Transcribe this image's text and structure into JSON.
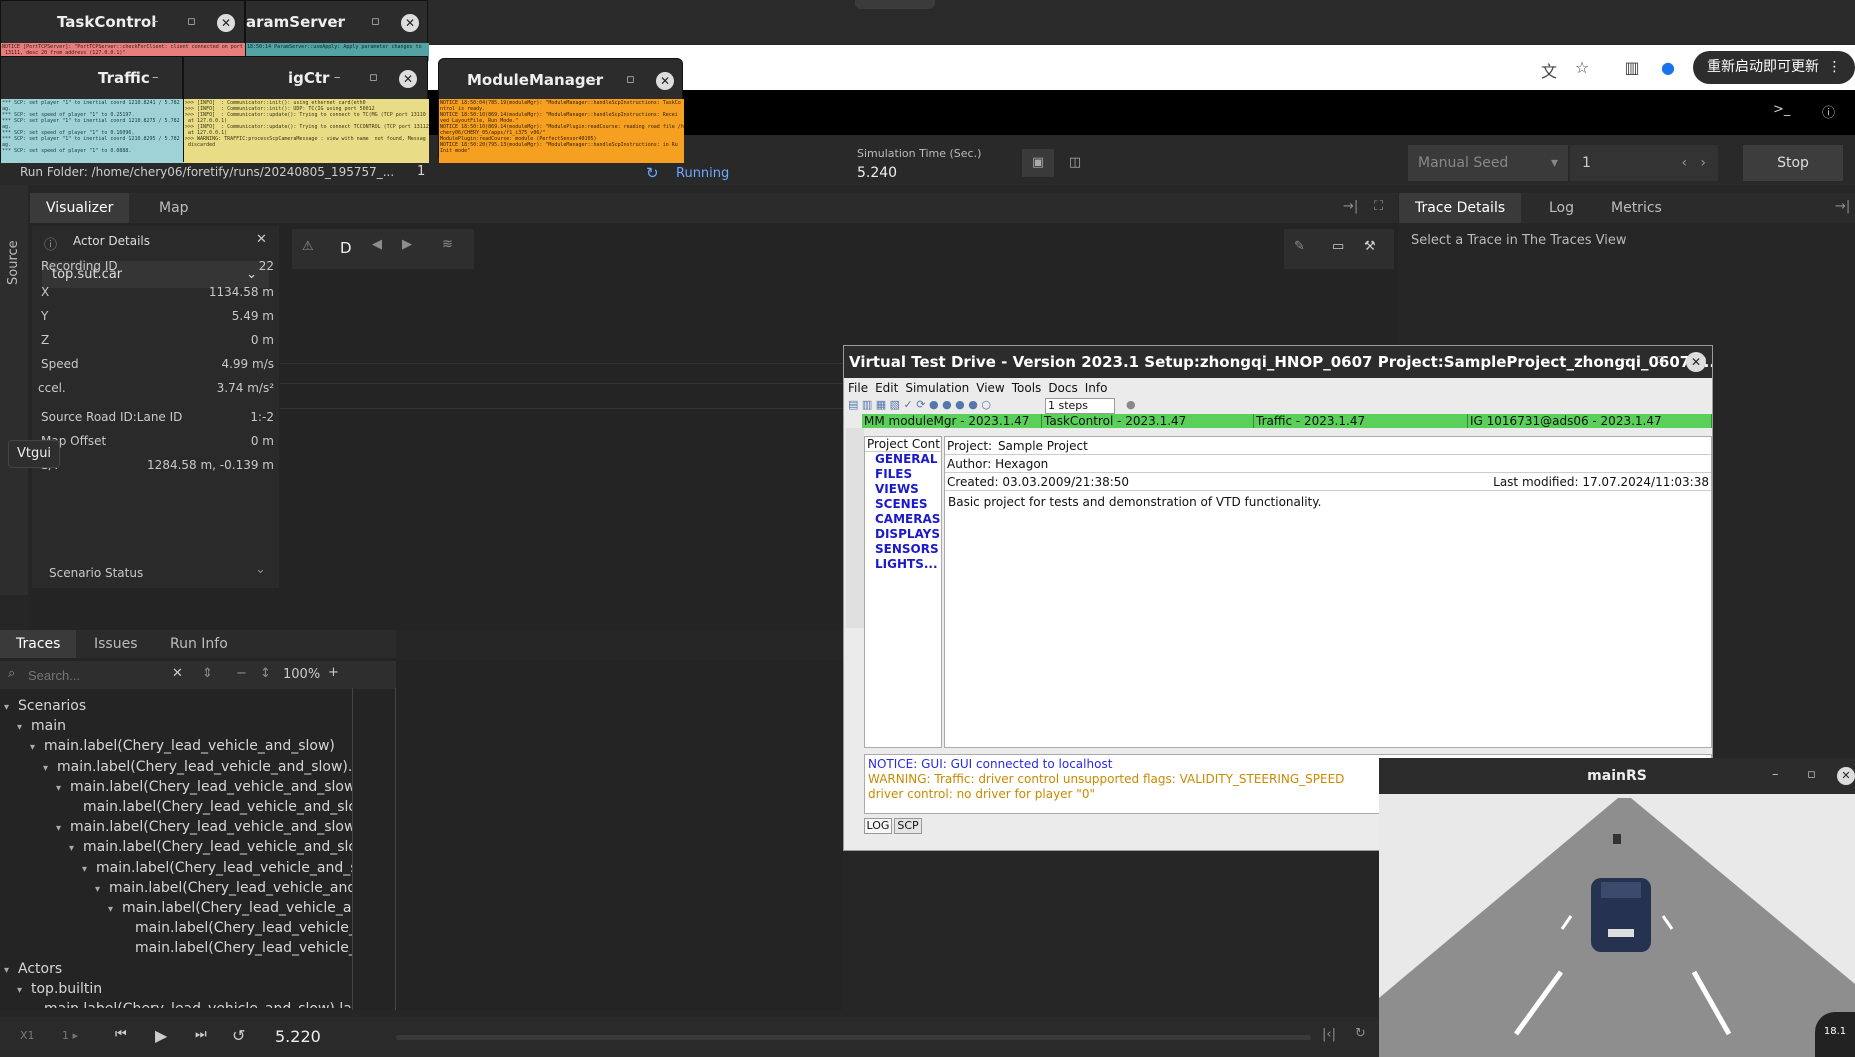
{
  "windows": {
    "task_control": {
      "title": "TaskControl",
      "log": "NOTICE [PortTCPServer]: \"PortTCPServer::checkForClient: client connected on port\n 13111, desc 20 from address (127.0.0.1)\""
    },
    "param_server": {
      "title": "aramServer",
      "log": "18:50:14 ParamServer::useApply: Apply parameter changes to"
    },
    "traffic": {
      "title": "Traffic",
      "log": "*** SCP: set player \"1\" to inertial coord 1210.8241 / 5.782\nag.\n*** SCP: set speed of player \"1\" to 0.25197.\n*** SCP: set player \"1\" to inertial coord 1210.8275 / 5.782\nag.\n*** SCP: set speed of player \"1\" to 0.16096.\n*** SCP: set player \"1\" to inertial coord 1210.8295 / 5.782\nag.\n*** SCP: set speed of player \"1\" to 0.0888."
    },
    "igctr": {
      "title": "igCtr",
      "log": ">>> [INFO]  : Communicator::init(): using ethernet card(eth0\n>>> [INFO]  : Communicator::init(): UDP: TC(IG using port 50012\n>>> [INFO]  : Communicator::update(): Trying to connect to TC(MG (TCP port 13110\n at 127.0.0.1)\n>>> [INFO]  : Communicator::update(): Trying to connect TCCONTROL (TCP port 13112\n at 127.0.0.1)\n>>> WARNING: TRAFFIC:processScpCameraMessage : view with name  not found, Messag\n discarded"
    },
    "module_manager": {
      "title": "ModuleManager",
      "log": "NOTICE 18:50:04(785.19(moduleMgr): \"ModuleManager::handleScpInstructions: TaskCo\nntrol is ready.\nNOTICE 18:50:10(869.14(moduleMgr): \"ModuleManager::handleScpInstructions: Recei\nved LayoutFile, Run Mode.\"\nNOTICE 18:50:10(869.14(moduleMgr): \"ModulePlugin:readCourse: reading road file /home/\nchery06/CHERY_05/apps/f1_i375_v06/\"\nModulePlugin:readCourse: module (PerfectSensor40105)\nNOTICE 18:50:20(795.13(moduleMgr): \"ModuleManager::handleScpInstructions: in Ru\nInit mode\""
    },
    "vtgui_tooltip": "Vtgui"
  },
  "browser": {
    "update_button": "重新启动即可更新",
    "icons": [
      "translate-icon",
      "star-icon",
      "sidebar-icon",
      "profile-icon",
      "more-vert-icon"
    ]
  },
  "toolbar": {
    "run_folder_label": "Run Folder: /home/chery06/foretify/runs/20240805_195757_...",
    "run_index": "1",
    "status": "Running",
    "sim_time_label": "Simulation Time (Sec.)",
    "sim_time_value": "5.240",
    "seed_mode": "Manual Seed",
    "seed_value": "1",
    "stop_label": "Stop"
  },
  "left_panel": {
    "tabs": [
      "Visualizer",
      "Map"
    ],
    "source_label": "Source",
    "view_buttons": [
      "D"
    ]
  },
  "actor_details": {
    "title": "Actor Details",
    "selected_actor": "top.sut.car",
    "fields": [
      {
        "key": "Recording ID",
        "value": "22"
      },
      {
        "key": "X",
        "value": "1134.58 m"
      },
      {
        "key": "Y",
        "value": "5.49 m"
      },
      {
        "key": "Z",
        "value": "0 m"
      },
      {
        "key": "Speed",
        "value": "4.99 m/s"
      },
      {
        "key": "ccel.",
        "value": "3.74 m/s²"
      },
      {
        "key": "Source Road ID:Lane ID",
        "value": "1:-2"
      },
      {
        "key": "Map Offset",
        "value": "0 m"
      },
      {
        "key": "S/T",
        "value": "1284.58 m, -0.139 m"
      }
    ],
    "scenario_status": "Scenario Status"
  },
  "right_panel": {
    "tabs": [
      "Trace Details",
      "Log",
      "Metrics"
    ],
    "placeholder": "Select a Trace in The Traces View"
  },
  "traces": {
    "tabs": [
      "Traces",
      "Issues",
      "Run Info"
    ],
    "search_placeholder": "Search...",
    "zoom": "100%",
    "tree": [
      {
        "label": "Scenarios",
        "depth": 0,
        "arrow": "▾"
      },
      {
        "label": "main",
        "depth": 1,
        "arrow": "▾"
      },
      {
        "label": "main.label(Chery_lead_vehicle_and_slow)",
        "depth": 2,
        "arrow": "▾"
      },
      {
        "label": "main.label(Chery_lead_vehicle_and_slow).la",
        "depth": 3,
        "arrow": "▾"
      },
      {
        "label": "main.label(Chery_lead_vehicle_and_slow)",
        "depth": 4,
        "arrow": "▾"
      },
      {
        "label": "main.label(Chery_lead_vehicle_and_slow",
        "depth": 5,
        "arrow": ""
      },
      {
        "label": "main.label(Chery_lead_vehicle_and_slow)",
        "depth": 4,
        "arrow": "▾"
      },
      {
        "label": "main.label(Chery_lead_vehicle_and_slow",
        "depth": 5,
        "arrow": "▾"
      },
      {
        "label": "main.label(Chery_lead_vehicle_and_sl",
        "depth": 6,
        "arrow": "▾"
      },
      {
        "label": "main.label(Chery_lead_vehicle_and_",
        "depth": 7,
        "arrow": "▾"
      },
      {
        "label": "main.label(Chery_lead_vehicle_an",
        "depth": 8,
        "arrow": "▾"
      },
      {
        "label": "main.label(Chery_lead_vehicle_a",
        "depth": 9,
        "arrow": ""
      },
      {
        "label": "main.label(Chery_lead_vehicle_a",
        "depth": 9,
        "arrow": ""
      },
      {
        "label": "Actors",
        "depth": 0,
        "arrow": "▾"
      },
      {
        "label": "top.builtin",
        "depth": 1,
        "arrow": "▾"
      },
      {
        "label": "main.label(Chery_lead_vehicle_and_slow).labe",
        "depth": 2,
        "arrow": ""
      }
    ]
  },
  "playback": {
    "speed": "X1",
    "step": "1 ▸",
    "time": "5.220"
  },
  "vtd": {
    "title": "Virtual Test Drive - Version 2023.1    Setup:zhongqi_HNOP_0607    Project:SampleProject_zhongqi_0607    P...",
    "menu": [
      "File",
      "Edit",
      "Simulation",
      "View",
      "Tools",
      "Docs",
      "Info"
    ],
    "steps": "1 steps",
    "status_segments": [
      "MM  moduleMgr - 2023.1.47",
      "TaskControl - 2023.1.47",
      "Traffic  - 2023.1.47",
      "IG  1016731@ads06 - 2023.1.47"
    ],
    "project_tree_header": "Project Contr",
    "project_tree": [
      "GENERAL",
      "FILES",
      "VIEWS",
      "SCENES",
      "CAMERAS",
      "DISPLAYS",
      "SENSORS",
      "LIGHTS..."
    ],
    "project_label": "Project:",
    "project_value": "Sample Project",
    "author_label": "Author:",
    "author_value": "Hexagon",
    "created_label": "Created:",
    "created_value": "03.03.2009/21:38:50",
    "modified": "Last modified: 17.07.2024/11:03:38",
    "description": "Basic project for tests and demonstration of VTD functionality.",
    "log_lines": [
      {
        "text": "NOTICE:    GUI: GUI connected to localhost",
        "color": "#2a2ae0"
      },
      {
        "text": "WARNING:  Traffic: driver control unsupported flags: VALIDITY_STEERING_SPEED",
        "color": "#c98a00"
      },
      {
        "text": "driver control: no driver for player \"0\"",
        "color": "#c98a00"
      }
    ],
    "log_tabs": [
      "LOG",
      "SCP"
    ]
  },
  "mainrs": {
    "title": "mainRS",
    "speedo": "18.1"
  }
}
